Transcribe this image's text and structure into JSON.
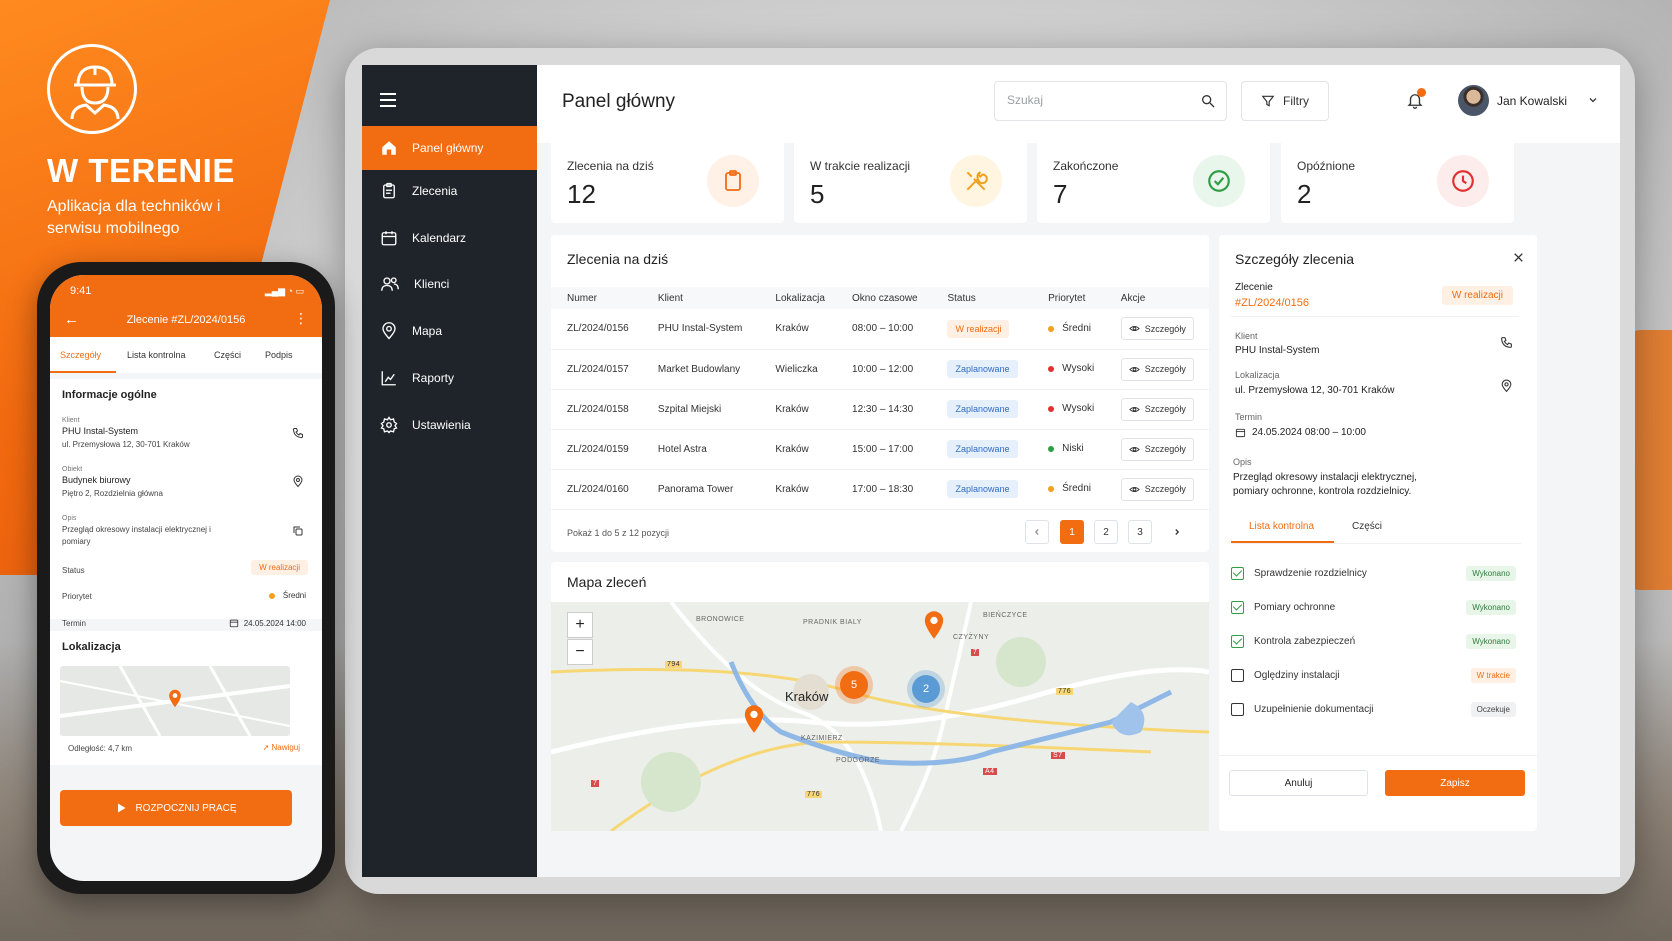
{
  "promo": {
    "title": "W TERENIE",
    "subtitle": "Aplikacja dla techników i serwisu mobilnego"
  },
  "sidebar": {
    "items": [
      {
        "label": "Panel główny",
        "icon": "home-icon",
        "active": true
      },
      {
        "label": "Zlecenia",
        "icon": "clipboard-icon"
      },
      {
        "label": "Kalendarz",
        "icon": "calendar-icon"
      },
      {
        "label": "Klienci",
        "icon": "users-icon"
      },
      {
        "label": "Mapa",
        "icon": "map-pin-icon"
      },
      {
        "label": "Raporty",
        "icon": "chart-icon"
      },
      {
        "label": "Ustawienia",
        "icon": "gear-icon"
      }
    ]
  },
  "header": {
    "title": "Panel główny",
    "search_placeholder": "Szukaj",
    "filter_label": "Filtry",
    "user_name": "Jan Kowalski"
  },
  "kpis": [
    {
      "label": "Zlecenia na dziś",
      "value": "12",
      "icon": "clipboard-icon",
      "color": "#f26c12"
    },
    {
      "label": "W trakcie realizacji",
      "value": "5",
      "icon": "tools-icon",
      "color": "#f0a020"
    },
    {
      "label": "Zakończone",
      "value": "7",
      "icon": "check-circle-icon",
      "color": "#2f9e44"
    },
    {
      "label": "Opóźnione",
      "value": "2",
      "icon": "clock-icon",
      "color": "#e03131"
    }
  ],
  "orders": {
    "title": "Zlecenia na dziś",
    "columns": [
      "Numer",
      "Klient",
      "Lokalizacja",
      "Okno czasowe",
      "Status",
      "Priorytet",
      "Akcje"
    ],
    "rows": [
      {
        "num": "ZL/2024/0156",
        "client": "PHU Instal-System",
        "loc": "Kraków",
        "time": "08:00 – 10:00",
        "status": "W realizacji",
        "status_type": "real",
        "priority": "Średni",
        "pcolor": "#f0a020",
        "action": "Szczegóły"
      },
      {
        "num": "ZL/2024/0157",
        "client": "Market Budowlany",
        "loc": "Wieliczka",
        "time": "10:00 – 12:00",
        "status": "Zaplanowane",
        "status_type": "plan",
        "priority": "Wysoki",
        "pcolor": "#e03131",
        "action": "Szczegóły"
      },
      {
        "num": "ZL/2024/0158",
        "client": "Szpital Miejski",
        "loc": "Kraków",
        "time": "12:30 – 14:30",
        "status": "Zaplanowane",
        "status_type": "plan",
        "priority": "Wysoki",
        "pcolor": "#e03131",
        "action": "Szczegóły"
      },
      {
        "num": "ZL/2024/0159",
        "client": "Hotel Astra",
        "loc": "Kraków",
        "time": "15:00 – 17:00",
        "status": "Zaplanowane",
        "status_type": "plan",
        "priority": "Niski",
        "pcolor": "#2f9e44",
        "action": "Szczegóły"
      },
      {
        "num": "ZL/2024/0160",
        "client": "Panorama Tower",
        "loc": "Kraków",
        "time": "17:00 – 18:30",
        "status": "Zaplanowane",
        "status_type": "plan",
        "priority": "Średni",
        "pcolor": "#f0a020",
        "action": "Szczegóły"
      }
    ],
    "pager_info": "Pokaż 1 do 5 z 12 pozycji",
    "pages": [
      "1",
      "2",
      "3"
    ]
  },
  "map": {
    "title": "Mapa zleceń",
    "city": "Kraków",
    "districts": [
      "BRONOWICE",
      "PRADNIK BIALY",
      "BIEŃCZYCE",
      "CZYŻYNY",
      "KAZIMIERZ",
      "PODGÓRZE"
    ],
    "roads": [
      "794",
      "776",
      "A4",
      "S7",
      "776",
      "7",
      "7"
    ],
    "clusters": [
      {
        "count": "5",
        "color": "#f26c12"
      },
      {
        "count": "2",
        "color": "#5b9bd5"
      }
    ]
  },
  "details": {
    "title": "Szczegóły zlecenia",
    "order_label": "Zlecenie",
    "order_number": "#ZL/2024/0156",
    "status": "W realizacji",
    "client_label": "Klient",
    "client": "PHU Instal-System",
    "location_label": "Lokalizacja",
    "location": "ul. Przemysłowa 12, 30-701 Kraków",
    "term_label": "Termin",
    "term": "24.05.2024 08:00 – 10:00",
    "desc_label": "Opis",
    "desc": "Przegląd okresowy instalacji elektrycznej, pomiary ochronne, kontrola rozdzielnicy.",
    "tabs": [
      "Lista kontrolna",
      "Części"
    ],
    "checklist": [
      {
        "label": "Sprawdzenie rozdzielnicy",
        "done": true,
        "badge": "Wykonano",
        "type": "done"
      },
      {
        "label": "Pomiary ochronne",
        "done": true,
        "badge": "Wykonano",
        "type": "done"
      },
      {
        "label": "Kontrola zabezpieczeń",
        "done": true,
        "badge": "Wykonano",
        "type": "done"
      },
      {
        "label": "Oględziny instalacji",
        "done": false,
        "badge": "W trakcie",
        "type": "prog"
      },
      {
        "label": "Uzupełnienie dokumentacji",
        "done": false,
        "badge": "Oczekuje",
        "type": "wait"
      }
    ],
    "cancel_label": "Anuluj",
    "save_label": "Zapisz"
  },
  "phone": {
    "time": "9:41",
    "title": "Zlecenie #ZL/2024/0156",
    "tabs": [
      "Szczegóły",
      "Lista kontrolna",
      "Części",
      "Podpis"
    ],
    "info_title": "Informacje ogólne",
    "client_label": "Klient",
    "client": "PHU Instal-System",
    "client_addr": "ul. Przemysłowa 12, 30-701 Kraków",
    "object_label": "Obiekt",
    "object": "Budynek biurowy",
    "object_sub": "Piętro 2, Rozdzielnia główna",
    "desc_label": "Opis",
    "desc": "Przegląd okresowy instalacji elektrycznej i pomiary",
    "status_label": "Status",
    "status": "W realizacji",
    "priority_label": "Priorytet",
    "priority": "Średni",
    "term_label": "Termin",
    "term": "24.05.2024 14:00",
    "loc_title": "Lokalizacja",
    "distance": "Odległość: 4,7 km",
    "navigate": "Nawiguj",
    "start": "ROZPOCZNIJ PRACĘ"
  }
}
